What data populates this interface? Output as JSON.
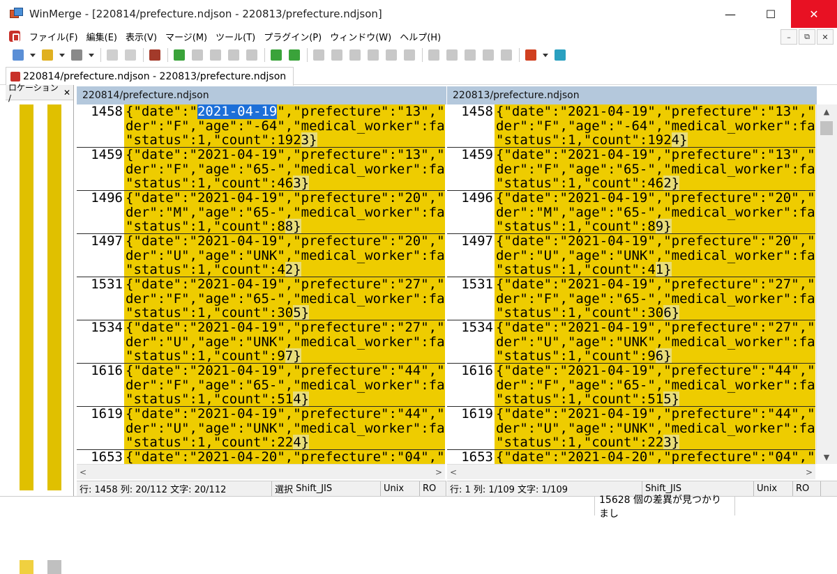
{
  "window": {
    "title": "WinMerge - [220814/prefecture.ndjson - 220813/prefecture.ndjson]",
    "minimize": "—",
    "maximize": "☐",
    "close": "✕"
  },
  "menu": {
    "items": [
      "ファイル(F)",
      "編集(E)",
      "表示(V)",
      "マージ(M)",
      "ツール(T)",
      "プラグイン(P)",
      "ウィンドウ(W)",
      "ヘルプ(H)"
    ],
    "mdi_minimize": "–",
    "mdi_restore": "⧉",
    "mdi_close": "✕"
  },
  "toolbar": {
    "icons": [
      {
        "name": "new-icon",
        "color": "#5b8fd6"
      },
      {
        "name": "dropdown-icon",
        "color": "#333333"
      },
      {
        "name": "open-icon",
        "color": "#e0b020"
      },
      {
        "name": "dropdown-icon",
        "color": "#333333"
      },
      {
        "name": "save-icon",
        "color": "#8a8a8a"
      },
      {
        "name": "dropdown-icon",
        "color": "#333333"
      },
      {
        "name": "undo-icon",
        "color": "#cfcfcf"
      },
      {
        "name": "redo-icon",
        "color": "#cfcfcf"
      },
      {
        "name": "filmstrip-icon",
        "color": "#a33a2a"
      },
      {
        "name": "next-diff-down-icon",
        "color": "#3aa33a"
      },
      {
        "name": "prev-diff-up-icon",
        "color": "#c8c8c8"
      },
      {
        "name": "first-diff-icon",
        "color": "#c8c8c8"
      },
      {
        "name": "last-diff-icon",
        "color": "#c8c8c8"
      },
      {
        "name": "current-diff-icon",
        "color": "#c8c8c8"
      },
      {
        "name": "next-conflict-icon",
        "color": "#3aa33a"
      },
      {
        "name": "prev-conflict-icon",
        "color": "#3aa33a"
      },
      {
        "name": "copy-right-icon",
        "color": "#c8c8c8"
      },
      {
        "name": "copy-left-icon",
        "color": "#c8c8c8"
      },
      {
        "name": "copy-right-advance-icon",
        "color": "#c8c8c8"
      },
      {
        "name": "copy-left-advance-icon",
        "color": "#c8c8c8"
      },
      {
        "name": "copy-all-right-icon",
        "color": "#c8c8c8"
      },
      {
        "name": "copy-all-left-icon",
        "color": "#c8c8c8"
      },
      {
        "name": "merge-icon",
        "color": "#c8c8c8"
      },
      {
        "name": "copy-from-left-icon",
        "color": "#c8c8c8"
      },
      {
        "name": "copy-to-left-icon",
        "color": "#c8c8c8"
      },
      {
        "name": "copy-to-right-icon",
        "color": "#c8c8c8"
      },
      {
        "name": "copy-from-right-icon",
        "color": "#c8c8c8"
      },
      {
        "name": "options-icon",
        "color": "#d04020"
      },
      {
        "name": "dropdown-icon",
        "color": "#333333"
      },
      {
        "name": "refresh-icon",
        "color": "#2aa0c0"
      }
    ]
  },
  "tab": {
    "label": "220814/prefecture.ndjson - 220813/prefecture.ndjson"
  },
  "location_pane": {
    "title": "ロケーション /",
    "close": "✕",
    "bar_color": "#e0c000"
  },
  "left_pane": {
    "header": "220814/prefecture.ndjson",
    "rows": [
      {
        "line": "1458",
        "l1a": "{\"date\":\"",
        "l1sel": "2021-04-19",
        "l1b": "\",\"prefecture\":\"13\",\"gen",
        "l2": "der\":\"F\",\"age\":\"-64\",\"medical_worker\":false,",
        "l3a": "\"status\":1,\"count\":",
        "l3h": "192",
        "l3b": "3}"
      },
      {
        "line": "1459",
        "l1a": "{\"date\":\"2021-04-19\",\"prefecture\":\"13\",\"gen",
        "l1sel": "",
        "l1b": "",
        "l2": "der\":\"F\",\"age\":\"65-\",\"medical_worker\":false,",
        "l3a": "\"status\":1,\"count\":",
        "l3h": "46",
        "l3b": "3}"
      },
      {
        "line": "1496",
        "l1a": "{\"date\":\"2021-04-19\",\"prefecture\":\"20\",\"gen",
        "l1sel": "",
        "l1b": "",
        "l2": "der\":\"M\",\"age\":\"65-\",\"medical_worker\":false,",
        "l3a": "\"status\":1,\"count\":",
        "l3h": "8",
        "l3b": "8}"
      },
      {
        "line": "1497",
        "l1a": "{\"date\":\"2021-04-19\",\"prefecture\":\"20\",\"gen",
        "l1sel": "",
        "l1b": "",
        "l2": "der\":\"U\",\"age\":\"UNK\",\"medical_worker\":false,",
        "l3a": "\"status\":1,\"count\":",
        "l3h": "4",
        "l3b": "2}"
      },
      {
        "line": "1531",
        "l1a": "{\"date\":\"2021-04-19\",\"prefecture\":\"27\",\"gen",
        "l1sel": "",
        "l1b": "",
        "l2": "der\":\"F\",\"age\":\"65-\",\"medical_worker\":false,",
        "l3a": "\"status\":1,\"count\":",
        "l3h": "30",
        "l3b": "5}"
      },
      {
        "line": "1534",
        "l1a": "{\"date\":\"2021-04-19\",\"prefecture\":\"27\",\"gen",
        "l1sel": "",
        "l1b": "",
        "l2": "der\":\"U\",\"age\":\"UNK\",\"medical_worker\":false,",
        "l3a": "\"status\":1,\"count\":",
        "l3h": "9",
        "l3b": "7}"
      },
      {
        "line": "1616",
        "l1a": "{\"date\":\"2021-04-19\",\"prefecture\":\"44\",\"gen",
        "l1sel": "",
        "l1b": "",
        "l2": "der\":\"F\",\"age\":\"65-\",\"medical_worker\":false,",
        "l3a": "\"status\":1,\"count\":",
        "l3h": "51",
        "l3b": "4}"
      },
      {
        "line": "1619",
        "l1a": "{\"date\":\"2021-04-19\",\"prefecture\":\"44\",\"gen",
        "l1sel": "",
        "l1b": "",
        "l2": "der\":\"U\",\"age\":\"UNK\",\"medical_worker\":false,",
        "l3a": "\"status\":1,\"count\":",
        "l3h": "22",
        "l3b": "4}"
      },
      {
        "line": "1653",
        "l1a": "{\"date\":\"2021-04-20\",\"prefecture\":\"04\",\"gen",
        "l1sel": "",
        "l1b": "",
        "l2": "",
        "l3a": "",
        "l3h": "",
        "l3b": ""
      }
    ]
  },
  "right_pane": {
    "header": "220813/prefecture.ndjson",
    "rows": [
      {
        "line": "1458",
        "l1a": "{\"date\":\"2021-04-19\",\"prefecture\":\"13\",\"gen",
        "l1sel": "",
        "l1b": "",
        "l2": "der\":\"F\",\"age\":\"-64\",\"medical_worker\":false,",
        "l3a": "\"status\":1,\"count\":",
        "l3h": "192",
        "l3b": "4}"
      },
      {
        "line": "1459",
        "l1a": "{\"date\":\"2021-04-19\",\"prefecture\":\"13\",\"gen",
        "l1sel": "",
        "l1b": "",
        "l2": "der\":\"F\",\"age\":\"65-\",\"medical_worker\":false,",
        "l3a": "\"status\":1,\"count\":",
        "l3h": "46",
        "l3b": "2}"
      },
      {
        "line": "1496",
        "l1a": "{\"date\":\"2021-04-19\",\"prefecture\":\"20\",\"gen",
        "l1sel": "",
        "l1b": "",
        "l2": "der\":\"M\",\"age\":\"65-\",\"medical_worker\":false,",
        "l3a": "\"status\":1,\"count\":",
        "l3h": "8",
        "l3b": "9}"
      },
      {
        "line": "1497",
        "l1a": "{\"date\":\"2021-04-19\",\"prefecture\":\"20\",\"gen",
        "l1sel": "",
        "l1b": "",
        "l2": "der\":\"U\",\"age\":\"UNK\",\"medical_worker\":false,",
        "l3a": "\"status\":1,\"count\":",
        "l3h": "4",
        "l3b": "1}"
      },
      {
        "line": "1531",
        "l1a": "{\"date\":\"2021-04-19\",\"prefecture\":\"27\",\"gen",
        "l1sel": "",
        "l1b": "",
        "l2": "der\":\"F\",\"age\":\"65-\",\"medical_worker\":false,",
        "l3a": "\"status\":1,\"count\":",
        "l3h": "30",
        "l3b": "6}"
      },
      {
        "line": "1534",
        "l1a": "{\"date\":\"2021-04-19\",\"prefecture\":\"27\",\"gen",
        "l1sel": "",
        "l1b": "",
        "l2": "der\":\"U\",\"age\":\"UNK\",\"medical_worker\":false,",
        "l3a": "\"status\":1,\"count\":",
        "l3h": "9",
        "l3b": "6}"
      },
      {
        "line": "1616",
        "l1a": "{\"date\":\"2021-04-19\",\"prefecture\":\"44\",\"gen",
        "l1sel": "",
        "l1b": "",
        "l2": "der\":\"F\",\"age\":\"65-\",\"medical_worker\":false,",
        "l3a": "\"status\":1,\"count\":",
        "l3h": "51",
        "l3b": "5}"
      },
      {
        "line": "1619",
        "l1a": "{\"date\":\"2021-04-19\",\"prefecture\":\"44\",\"gen",
        "l1sel": "",
        "l1b": "",
        "l2": "der\":\"U\",\"age\":\"UNK\",\"medical_worker\":false,",
        "l3a": "\"status\":1,\"count\":",
        "l3h": "22",
        "l3b": "3}"
      },
      {
        "line": "1653",
        "l1a": "{\"date\":\"2021-04-20\",\"prefecture\":\"04\",\"gen",
        "l1sel": "",
        "l1b": "",
        "l2": "",
        "l3a": "",
        "l3h": "",
        "l3b": ""
      }
    ]
  },
  "scroll": {
    "left_arrow": "<",
    "right_arrow": ">",
    "up_arrow": "▲",
    "down_arrow": "▼"
  },
  "status_left": {
    "pos": "行: 1458  列: 20/112  文字: 20/112",
    "sel": "選択",
    "enc": "Shift_JIS",
    "eol": "Unix",
    "ro": "RO"
  },
  "status_right": {
    "pos": "行: 1  列: 1/109  文字: 1/109",
    "enc": "Shift_JIS",
    "eol": "Unix",
    "ro": "RO"
  },
  "main_status": {
    "message": "15628 個の差異が見つかりまし"
  },
  "colors": {
    "diff_yellow": "#eecc00",
    "header_blue": "#b4c8dc",
    "selection": "#1c6fd8",
    "close_red": "#e81123"
  }
}
